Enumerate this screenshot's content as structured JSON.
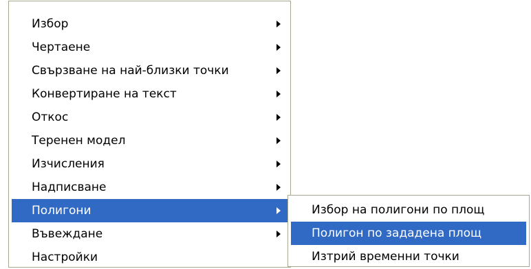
{
  "main_menu": {
    "items": [
      {
        "label": "Избор",
        "submenu": true
      },
      {
        "label": "Чертаене",
        "submenu": true
      },
      {
        "label": "Свързване на най-близки точки",
        "submenu": true
      },
      {
        "label": "Конвертиране на текст",
        "submenu": true
      },
      {
        "label": "Откос",
        "submenu": true
      },
      {
        "label": "Теренен модел",
        "submenu": true
      },
      {
        "label": "Изчисления",
        "submenu": true
      },
      {
        "label": "Надписване",
        "submenu": true
      },
      {
        "label": "Полигони",
        "submenu": true,
        "selected": true
      },
      {
        "label": "Въвеждане",
        "submenu": true
      },
      {
        "label": "Настройки",
        "submenu": false
      }
    ]
  },
  "sub_menu": {
    "items": [
      {
        "label": "Избор на полигони по площ"
      },
      {
        "label": "Полигон по зададена площ",
        "selected": true
      },
      {
        "label": "Изтрий временни точки"
      }
    ]
  },
  "colors": {
    "highlight": "#316ac5",
    "highlight_text": "#ffffff",
    "border": "#a7a68f",
    "background": "#ffffff"
  },
  "icons": {
    "submenu_arrow": "chevron-right-icon"
  }
}
